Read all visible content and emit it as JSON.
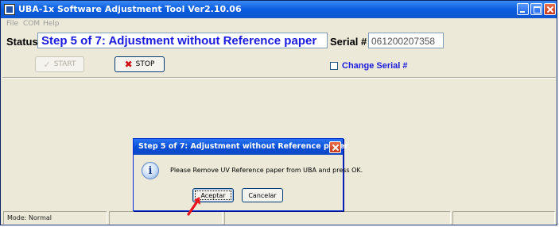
{
  "window": {
    "title": "UBA-1x Software Adjustment Tool Ver2.10.06"
  },
  "menu": {
    "items": [
      "File",
      "COM",
      "Help"
    ]
  },
  "header": {
    "status_label": "Status",
    "status_value": "Step 5 of 7: Adjustment without Reference paper",
    "serial_label": "Serial #",
    "serial_value": "061200207358"
  },
  "toolbar": {
    "start_label": "START",
    "start_icon": "checkmark-icon",
    "stop_label": "STOP",
    "stop_icon": "red-x-icon",
    "change_serial_label": "Change Serial #",
    "change_serial_checked": false
  },
  "statusbar": {
    "mode": "Mode: Normal"
  },
  "dialog": {
    "title": "Step 5 of 7: Adjustment without Reference paper",
    "icon": "info-icon",
    "message": "Please Remove UV Reference paper from UBA and press OK.",
    "ok_label": "Aceptar",
    "cancel_label": "Cancelar"
  },
  "colors": {
    "title_bar": "#0a5ce0",
    "status_text": "#1a1ae0",
    "annotation_arrow": "#e8121e",
    "stop_icon": "#d11010"
  }
}
